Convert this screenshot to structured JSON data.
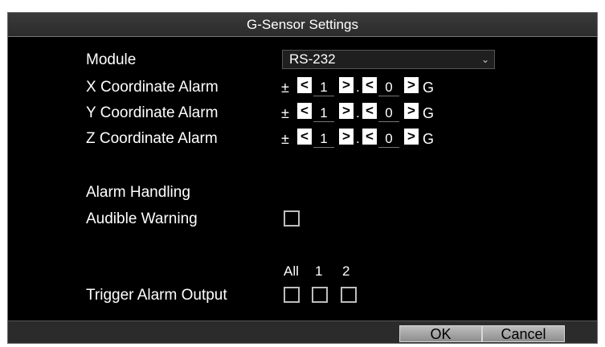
{
  "dialog": {
    "title": "G-Sensor Settings"
  },
  "module": {
    "label": "Module",
    "value": "RS-232",
    "chevron": "⌄"
  },
  "coordinates": [
    {
      "label": "X Coordinate Alarm",
      "sign": "±",
      "integer": "1",
      "decimal": "0",
      "unit": "G"
    },
    {
      "label": "Y Coordinate Alarm",
      "sign": "±",
      "integer": "1",
      "decimal": "0",
      "unit": "G"
    },
    {
      "label": "Z Coordinate Alarm",
      "sign": "±",
      "integer": "1",
      "decimal": "0",
      "unit": "G"
    }
  ],
  "alarm_handling": {
    "heading": "Alarm Handling",
    "audible_warning_label": "Audible Warning"
  },
  "trigger": {
    "label": "Trigger Alarm Output",
    "headers": [
      "All",
      "1",
      "2"
    ]
  },
  "buttons": {
    "ok": "OK",
    "cancel": "Cancel"
  },
  "icons": {
    "left": "left-chevron-icon",
    "right": "right-chevron-icon"
  },
  "colors": {
    "background": "#000000",
    "text": "#ffffff",
    "button": "#a8a8a8"
  }
}
